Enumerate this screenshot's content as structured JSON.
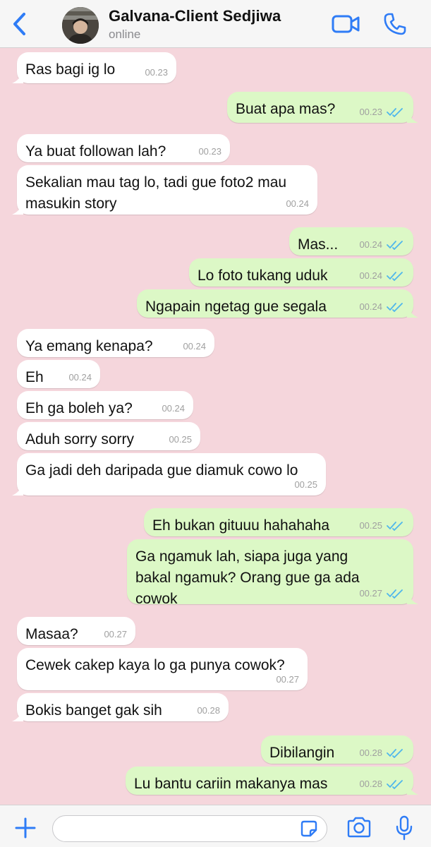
{
  "header": {
    "contact_name": "Galvana-Client Sedjiwa",
    "status": "online"
  },
  "messages": [
    {
      "dir": "in",
      "text": "Ras bagi ig lo",
      "time": "00.23"
    },
    {
      "dir": "out",
      "text": "Buat apa mas?",
      "time": "00.23"
    },
    {
      "dir": "in",
      "text": "Ya buat followan lah?",
      "time": "00.23"
    },
    {
      "dir": "in",
      "text": "Sekalian mau tag lo, tadi gue foto2 mau masukin story",
      "time": "00.24"
    },
    {
      "dir": "out",
      "text": "Mas...",
      "time": "00.24"
    },
    {
      "dir": "out",
      "text": "Lo foto tukang uduk",
      "time": "00.24"
    },
    {
      "dir": "out",
      "text": "Ngapain ngetag gue segala",
      "time": "00.24"
    },
    {
      "dir": "in",
      "text": "Ya emang kenapa?",
      "time": "00.24"
    },
    {
      "dir": "in",
      "text": "Eh",
      "time": "00.24"
    },
    {
      "dir": "in",
      "text": "Eh ga boleh ya?",
      "time": "00.24"
    },
    {
      "dir": "in",
      "text": "Aduh sorry sorry",
      "time": "00.25"
    },
    {
      "dir": "in",
      "text": "Ga jadi deh daripada gue diamuk cowo lo",
      "time": "00.25"
    },
    {
      "dir": "out",
      "text": "Eh bukan gituuu hahahaha",
      "time": "00.25"
    },
    {
      "dir": "out",
      "text": "Ga ngamuk lah, siapa juga yang bakal ngamuk? Orang gue ga ada cowok",
      "time": "00.27"
    },
    {
      "dir": "in",
      "text": "Masaa?",
      "time": "00.27"
    },
    {
      "dir": "in",
      "text": "Cewek cakep kaya lo ga punya cowok?",
      "time": "00.27"
    },
    {
      "dir": "in",
      "text": "Bokis banget gak sih",
      "time": "00.28"
    },
    {
      "dir": "out",
      "text": "Dibilangin",
      "time": "00.28"
    },
    {
      "dir": "out",
      "text": "Lu bantu cariin makanya mas",
      "time": "00.28"
    }
  ],
  "footer": {
    "input_placeholder": ""
  },
  "colors": {
    "accent": "#2f7cf6",
    "chat_background": "#f5d6dc",
    "outgoing_bubble": "#dcf8c6",
    "incoming_bubble": "#ffffff",
    "read_ticks": "#4fb6ec"
  },
  "icons": [
    "back-chevron-icon",
    "video-call-icon",
    "phone-call-icon",
    "plus-icon",
    "sticker-icon",
    "camera-icon",
    "microphone-icon",
    "double-check-icon"
  ]
}
